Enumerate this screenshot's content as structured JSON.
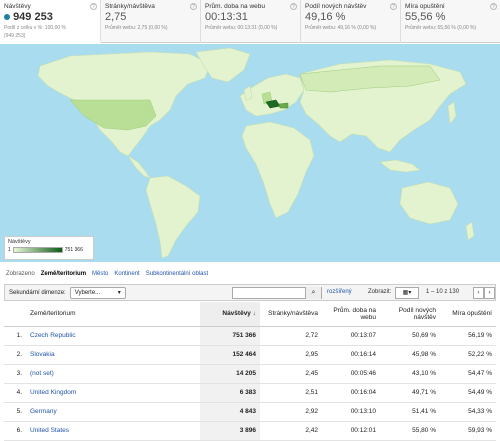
{
  "tiles": [
    {
      "label": "Návštěvy",
      "value": "949 253",
      "sub1": "Podíl z celku v %: 100,00 %",
      "sub2": "(949 253)",
      "active": true
    },
    {
      "label": "Stránky/návštěva",
      "value": "2,75",
      "sub1": "Průměr webu: 2,75 (0,00 %)",
      "sub2": ""
    },
    {
      "label": "Prům. doba na webu",
      "value": "00:13:31",
      "sub1": "Průměr webu: 00:13:31 (0,00 %)",
      "sub2": ""
    },
    {
      "label": "Podíl nových návštěv",
      "value": "49,16 %",
      "sub1": "Průměr webu: 49,16 % (0,00 %)",
      "sub2": ""
    },
    {
      "label": "Míra opuštění",
      "value": "55,56 %",
      "sub1": "Průměr webu: 55,56 % (0,00 %)",
      "sub2": ""
    }
  ],
  "legend": {
    "title": "Návštěvy",
    "min": "1",
    "max": "751 366"
  },
  "views": {
    "label": "Zobrazeno",
    "active": "Země/teritorium",
    "links": [
      "Město",
      "Kontinent",
      "Subkontinentální oblast"
    ]
  },
  "toolbar": {
    "secondary_label": "Sekundární dimenze:",
    "secondary_value": "Vyberte...",
    "advanced": "rozšířený",
    "show": "Zobrazit:",
    "rows_value": "10",
    "range": "1 – 10 z 130"
  },
  "table": {
    "headers": [
      "Země/teritorium",
      "Návštěvy",
      "Stránky/návštěva",
      "Prům. doba na webu",
      "Podíl nových návštěv",
      "Míra opuštění"
    ],
    "rows": [
      {
        "n": "1.",
        "name": "Czech Republic",
        "visits": "751 366",
        "pages": "2,72",
        "dur": "00:13:07",
        "new": "50,69 %",
        "bounce": "56,19 %"
      },
      {
        "n": "2.",
        "name": "Slovakia",
        "visits": "152 464",
        "pages": "2,95",
        "dur": "00:16:14",
        "new": "45,98 %",
        "bounce": "52,22 %"
      },
      {
        "n": "3.",
        "name": "(not set)",
        "visits": "14 205",
        "pages": "2,45",
        "dur": "00:05:46",
        "new": "43,10 %",
        "bounce": "54,47 %"
      },
      {
        "n": "4.",
        "name": "United Kingdom",
        "visits": "6 383",
        "pages": "2,51",
        "dur": "00:16:04",
        "new": "49,71 %",
        "bounce": "54,49 %"
      },
      {
        "n": "5.",
        "name": "Germany",
        "visits": "4 843",
        "pages": "2,92",
        "dur": "00:13:10",
        "new": "51,41 %",
        "bounce": "54,33 %"
      },
      {
        "n": "6.",
        "name": "United States",
        "visits": "3 896",
        "pages": "2,42",
        "dur": "00:12:01",
        "new": "55,80 %",
        "bounce": "59,93 %"
      }
    ]
  },
  "colors": {
    "ocean": "#a9dcee",
    "land_light": "#e3f2cf",
    "land_top": "#1c6b23",
    "link": "#2255aa"
  }
}
